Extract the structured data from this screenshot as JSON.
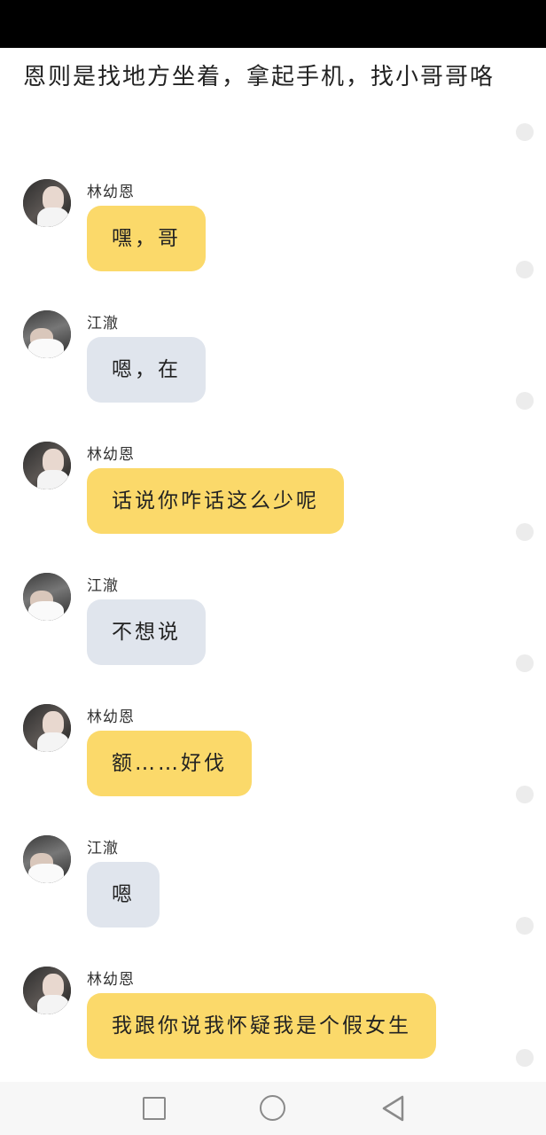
{
  "narration": "恩则是找地方坐着，拿起手机，找小哥哥咯",
  "messages": [
    {
      "sender": "林幼恩",
      "text": "嘿，哥"
    },
    {
      "sender": "江澈",
      "text": "嗯，在"
    },
    {
      "sender": "林幼恩",
      "text": "话说你咋话这么少呢"
    },
    {
      "sender": "江澈",
      "text": "不想说"
    },
    {
      "sender": "林幼恩",
      "text": "额……好伐"
    },
    {
      "sender": "江澈",
      "text": "嗯"
    },
    {
      "sender": "林幼恩",
      "text": "我跟你说我怀疑我是个假女生"
    }
  ],
  "colors": {
    "lin_bubble": "#fbd96a",
    "jiang_bubble": "#e0e5ed",
    "status_bar": "#000000",
    "nav_bar": "#f7f7f7"
  },
  "navigation": {
    "icons": [
      "square-recents-icon",
      "circle-home-icon",
      "triangle-back-icon"
    ]
  }
}
